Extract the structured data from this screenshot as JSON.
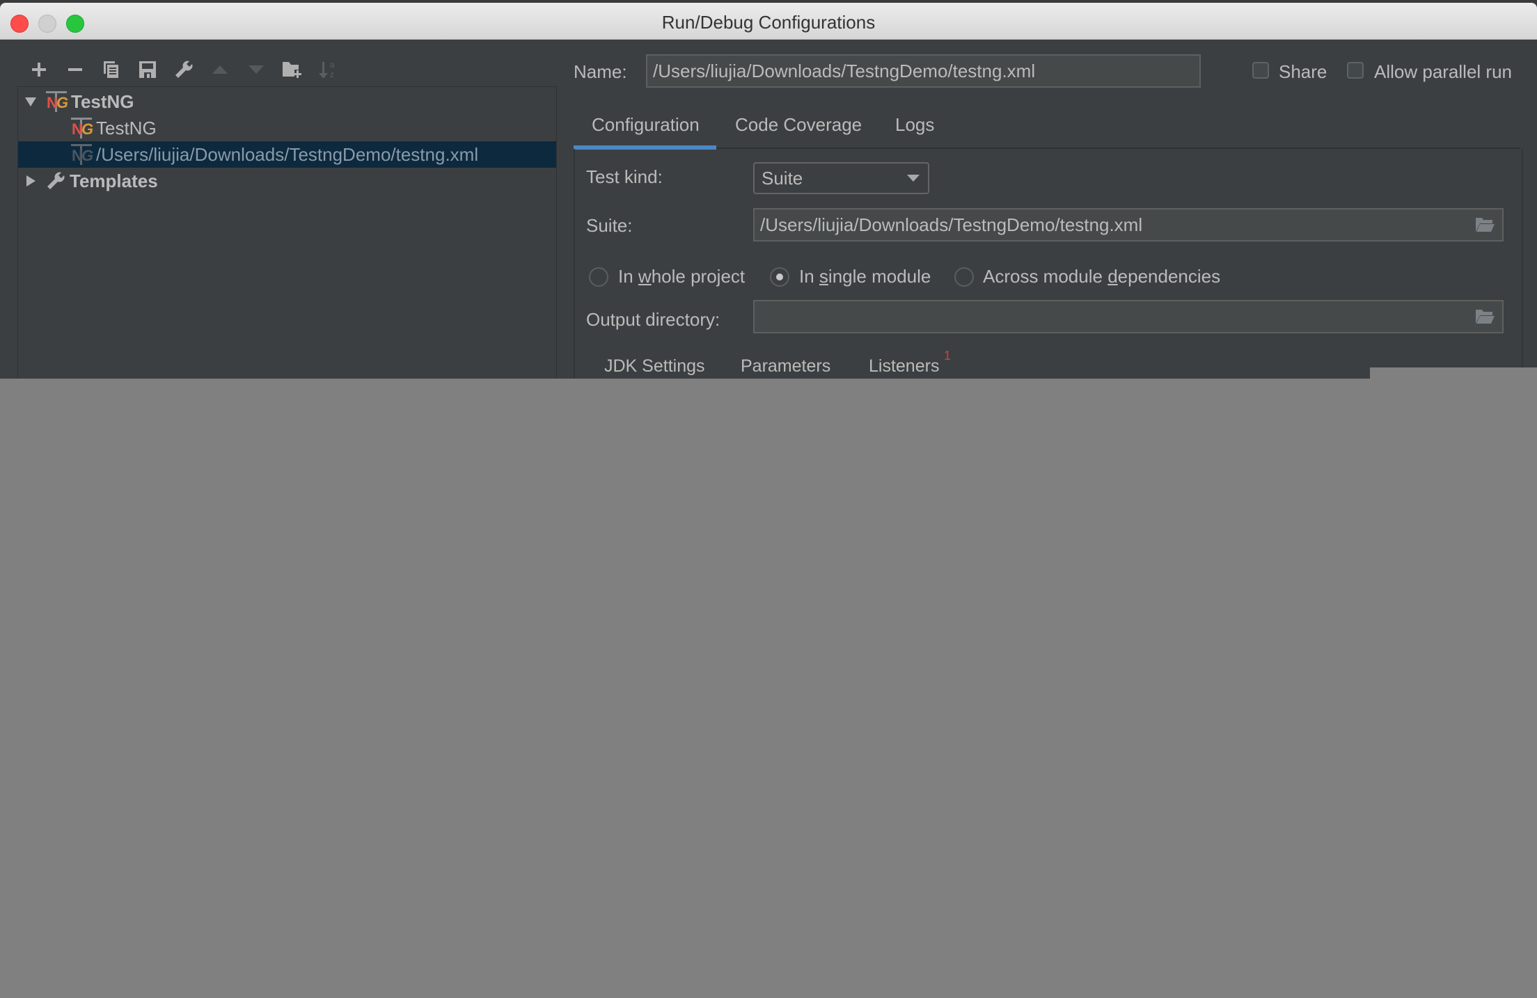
{
  "window": {
    "title": "Run/Debug Configurations",
    "traffic_lights": [
      "close",
      "minimize",
      "maximize"
    ]
  },
  "toolbar": {
    "buttons": [
      {
        "name": "add",
        "icon": "plus-icon"
      },
      {
        "name": "remove",
        "icon": "minus-icon"
      },
      {
        "name": "copy",
        "icon": "copy-icon"
      },
      {
        "name": "save",
        "icon": "save-icon"
      },
      {
        "name": "edit-defaults",
        "icon": "wrench-icon"
      },
      {
        "name": "move-up",
        "icon": "triangle-up-icon",
        "enabled": false
      },
      {
        "name": "move-down",
        "icon": "triangle-down-icon",
        "enabled": false
      },
      {
        "name": "new-folder",
        "icon": "folder-plus-icon"
      },
      {
        "name": "sort",
        "icon": "sort-az-icon",
        "enabled": false
      }
    ]
  },
  "tree": {
    "items": [
      {
        "label": "TestNG",
        "level": 0,
        "expanded": true,
        "bold": true,
        "icon": "testng-icon"
      },
      {
        "label": "TestNG",
        "level": 1,
        "icon": "testng-icon"
      },
      {
        "label": "/Users/liujia/Downloads/TestngDemo/testng.xml",
        "level": 1,
        "selected": true,
        "icon": "testng-icon"
      },
      {
        "label": "Templates",
        "level": 0,
        "expanded": false,
        "bold": true,
        "icon": "wrench-icon"
      }
    ]
  },
  "header": {
    "name_label": "Name:",
    "name_value": "/Users/liujia/Downloads/TestngDemo/testng.xml",
    "share_label": "Share",
    "share_checked": false,
    "parallel_label": "Allow parallel run",
    "parallel_checked": false
  },
  "tabs": [
    {
      "label": "Configuration",
      "active": true
    },
    {
      "label": "Code Coverage",
      "active": false
    },
    {
      "label": "Logs",
      "active": false
    }
  ],
  "config": {
    "test_kind_label": "Test kind:",
    "test_kind_value": "Suite",
    "suite_label": "Suite:",
    "suite_value": "/Users/liujia/Downloads/TestngDemo/testng.xml",
    "scope_options": [
      {
        "pre": "In ",
        "mnemonic": "w",
        "post": "hole project",
        "selected": false
      },
      {
        "pre": "In ",
        "mnemonic": "s",
        "post": "ingle module",
        "selected": true
      },
      {
        "pre": "Across module ",
        "mnemonic": "d",
        "post": "ependencies",
        "selected": false
      }
    ],
    "output_dir_label": "Output directory:",
    "output_dir_value": ""
  },
  "subtabs": [
    {
      "label": "JDK Settings"
    },
    {
      "label": "Parameters"
    },
    {
      "label": "Listeners",
      "badge": "1"
    }
  ],
  "colors": {
    "accent": "#4a88c7",
    "selection": "#0d293e",
    "badge": "#e0393e",
    "panel": "#3c3f41"
  }
}
